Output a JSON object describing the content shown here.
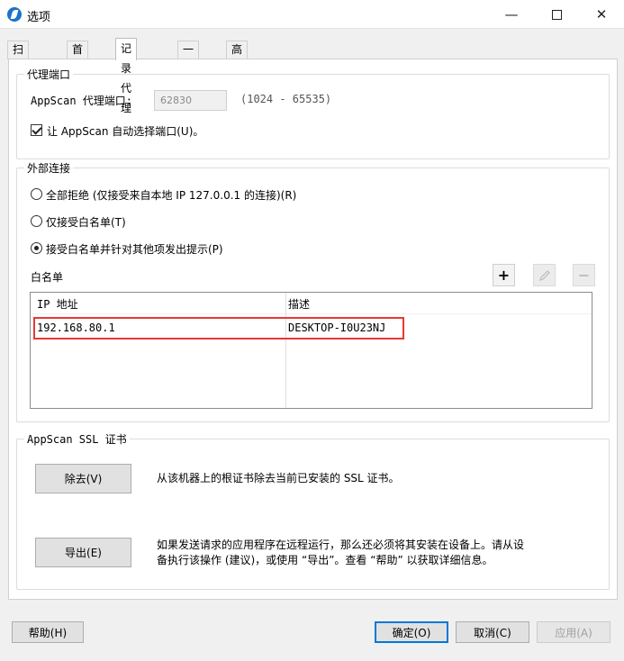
{
  "window": {
    "title": "选项",
    "minimize": "—",
    "close": "✕"
  },
  "tabs": [
    {
      "label": "扫描选项"
    },
    {
      "label": "首选项"
    },
    {
      "label": "记录代理"
    },
    {
      "label": "一般"
    },
    {
      "label": "高级"
    }
  ],
  "proxy_port": {
    "legend": "代理端口",
    "port_label": "AppScan 代理端口:",
    "port_value": "62830",
    "port_range": "(1024 - 65535)",
    "auto_port_label": "让 AppScan 自动选择端口(U)。",
    "auto_port_checked": true
  },
  "external": {
    "legend": "外部连接",
    "options": [
      {
        "label": "全部拒绝 (仅接受来自本地 IP 127.0.0.1 的连接)(R)",
        "checked": false
      },
      {
        "label": "仅接受白名单(T)",
        "checked": false
      },
      {
        "label": "接受白名单并针对其他项发出提示(P)",
        "checked": true
      }
    ],
    "whitelist_label": "白名单",
    "table": {
      "columns": [
        "IP 地址",
        "描述"
      ],
      "rows": [
        [
          "192.168.80.1",
          "DESKTOP-I0U23NJ"
        ]
      ]
    }
  },
  "ssl": {
    "legend": "AppScan SSL 证书",
    "remove_button": "除去(V)",
    "remove_desc": "从该机器上的根证书除去当前已安装的 SSL 证书。",
    "export_button": "导出(E)",
    "export_desc_line1": "如果发送请求的应用程序在远程运行，那么还必须将其安装在设备上。请从设",
    "export_desc_line2": "备执行该操作 (建议)，或使用 “导出”。查看 “帮助” 以获取详细信息。"
  },
  "footer": {
    "help": "帮助(H)",
    "ok": "确定(O)",
    "cancel": "取消(C)",
    "apply": "应用(A)"
  },
  "icons": {
    "app": "app-icon",
    "add": "plus-icon",
    "edit": "pencil-icon",
    "remove": "minus-icon"
  },
  "colors": {
    "highlight": "#e53935",
    "primary_border": "#0078d7"
  }
}
